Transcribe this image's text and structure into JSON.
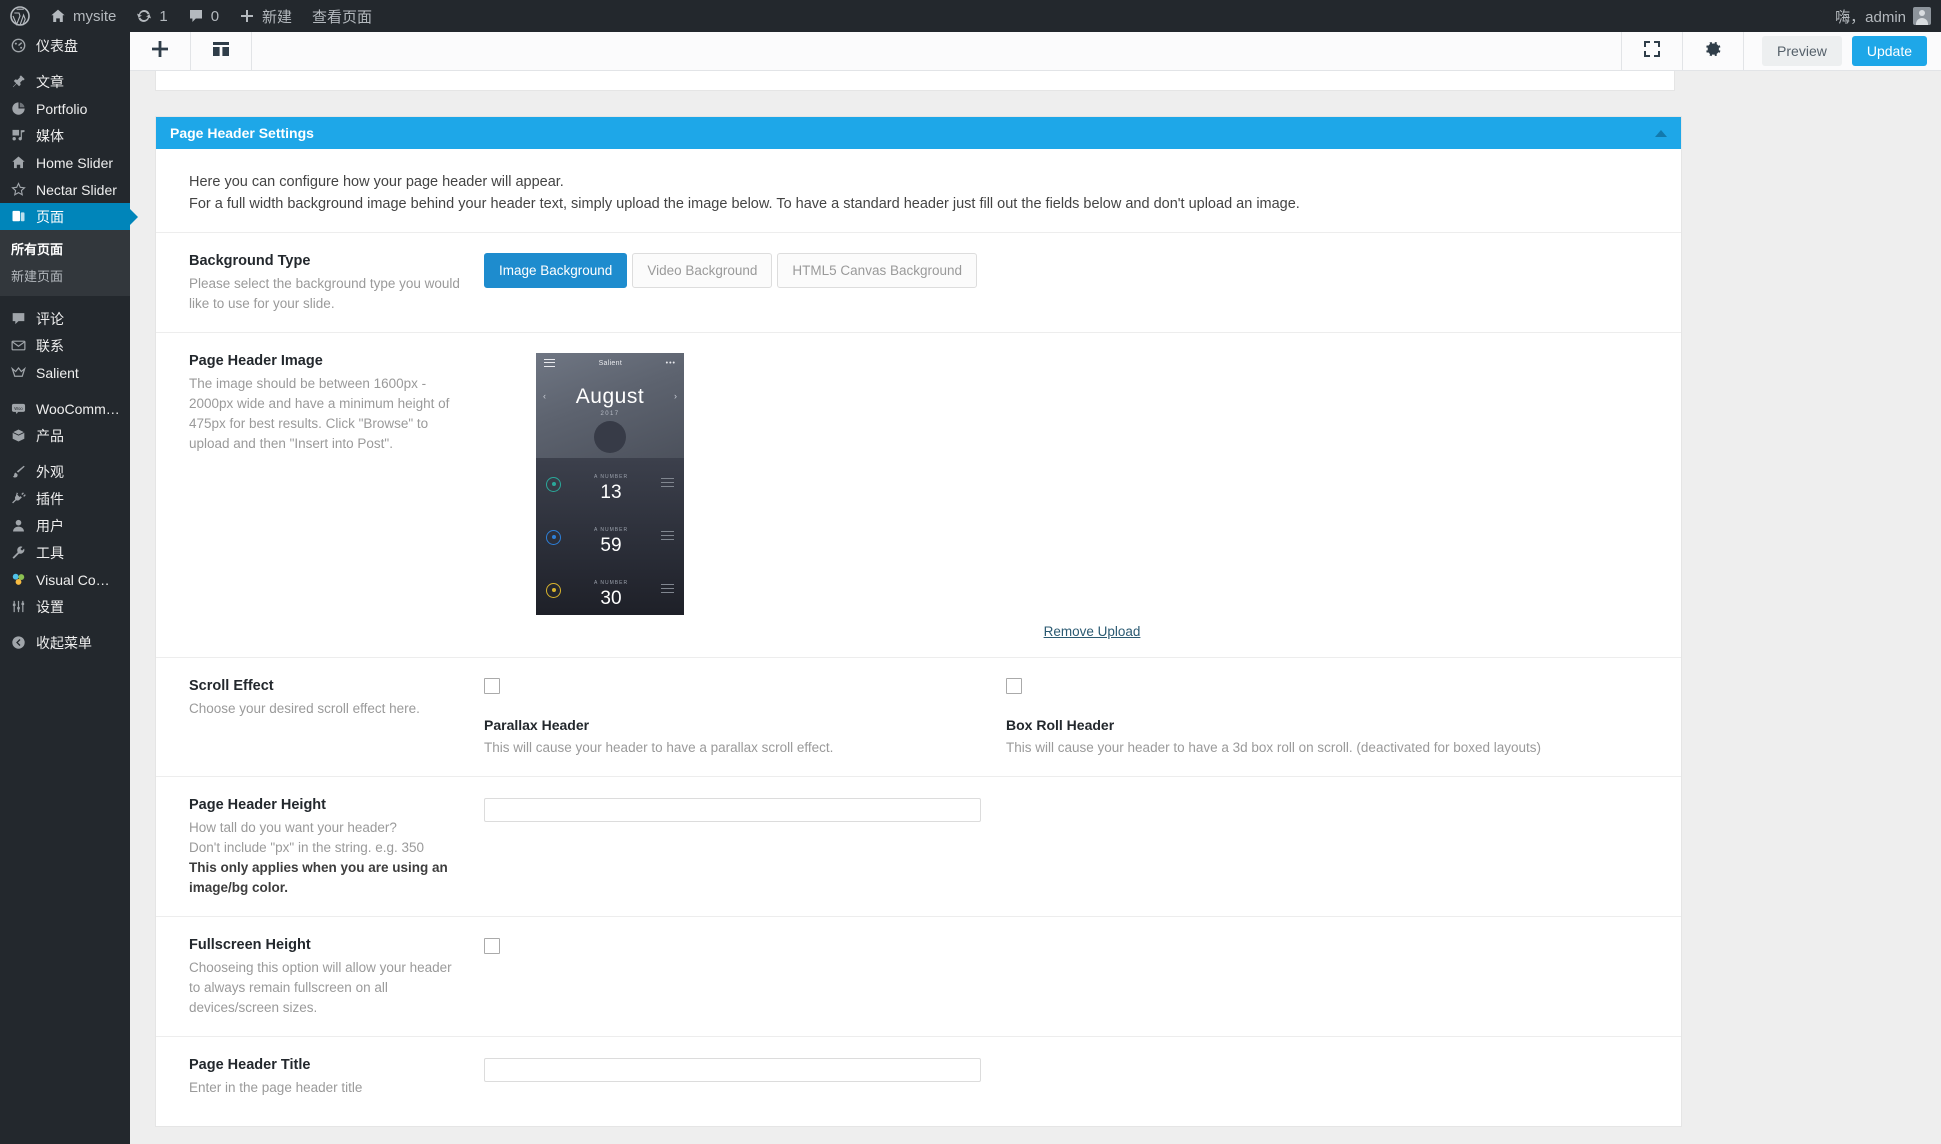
{
  "adminbar": {
    "logo_icon": "wordpress-logo-icon",
    "site_name": "mysite",
    "home_icon": "home-icon",
    "updates_icon": "updates-icon",
    "updates_count": "1",
    "comments_icon": "comment-bubble-icon",
    "comments_count": "0",
    "new_icon": "plus-icon",
    "new_label": "新建",
    "view_page_label": "查看页面",
    "account_greeting": "嗨，admin",
    "avatar_icon": "avatar-icon"
  },
  "sidebar": {
    "items": [
      {
        "label": "仪表盘",
        "icon": "dashboard-icon",
        "sep": false,
        "active": false
      },
      {
        "label": "文章",
        "icon": "pin-icon",
        "sep": true,
        "active": false
      },
      {
        "label": "Portfolio",
        "icon": "portfolio-icon",
        "sep": false,
        "active": false
      },
      {
        "label": "媒体",
        "icon": "media-icon",
        "sep": false,
        "active": false
      },
      {
        "label": "Home Slider",
        "icon": "home-icon",
        "sep": false,
        "active": false
      },
      {
        "label": "Nectar Slider",
        "icon": "star-icon",
        "sep": false,
        "active": false
      },
      {
        "label": "页面",
        "icon": "pages-icon",
        "sep": false,
        "active": true
      }
    ],
    "submenu": [
      {
        "label": "所有页面",
        "current": true
      },
      {
        "label": "新建页面",
        "current": false
      }
    ],
    "items2": [
      {
        "label": "评论",
        "icon": "comment-bubble-icon",
        "sep": true,
        "active": false
      },
      {
        "label": "联系",
        "icon": "envelope-icon",
        "sep": false,
        "active": false
      },
      {
        "label": "Salient",
        "icon": "crown-icon",
        "sep": false,
        "active": false
      },
      {
        "label": "WooCommerce",
        "icon": "woo-icon",
        "sep": true,
        "active": false
      },
      {
        "label": "产品",
        "icon": "box-icon",
        "sep": false,
        "active": false
      },
      {
        "label": "外观",
        "icon": "brush-icon",
        "sep": true,
        "active": false
      },
      {
        "label": "插件",
        "icon": "plug-icon",
        "sep": false,
        "active": false
      },
      {
        "label": "用户",
        "icon": "user-icon",
        "sep": false,
        "active": false
      },
      {
        "label": "工具",
        "icon": "wrench-icon",
        "sep": false,
        "active": false
      },
      {
        "label": "Visual Composer",
        "icon": "visual-composer-icon",
        "sep": false,
        "active": false
      },
      {
        "label": "设置",
        "icon": "settings-sliders-icon",
        "sep": false,
        "active": false
      },
      {
        "label": "收起菜单",
        "icon": "collapse-icon",
        "sep": true,
        "active": false
      }
    ]
  },
  "toolbar": {
    "add_icon": "plus-icon",
    "layout_icon": "layout-blocks-icon",
    "fullscreen_icon": "fullscreen-icon",
    "settings_icon": "gear-icon",
    "preview_label": "Preview",
    "update_label": "Update"
  },
  "panel": {
    "title": "Page Header Settings",
    "collapse_icon": "caret-up-icon",
    "intro_line1": "Here you can configure how your page header will appear.",
    "intro_line2": "For a full width background image behind your header text, simply upload the image below. To have a standard header just fill out the fields below and don't upload an image."
  },
  "background_type": {
    "label": "Background Type",
    "desc": "Please select the background type you would like to use for your slide.",
    "options": [
      {
        "label": "Image Background",
        "selected": true
      },
      {
        "label": "Video Background",
        "selected": false
      },
      {
        "label": "HTML5 Canvas Background",
        "selected": false
      }
    ]
  },
  "page_header_image": {
    "label": "Page Header Image",
    "desc": "The image should be between 1600px - 2000px wide and have a minimum height of 475px for best results. Click \"Browse\" to upload and then \"Insert into Post\".",
    "remove_label": "Remove Upload",
    "thumbnail": {
      "app_name": "Salient",
      "menu_icon": "hamburger-icon",
      "more_icon": "more-dots-icon",
      "month": "August",
      "year": "2017",
      "prev_icon": "chevron-left-icon",
      "next_icon": "chevron-right-icon",
      "rows": [
        {
          "caption": "A NUMBER",
          "value": "13",
          "color": "#2aa89a"
        },
        {
          "caption": "A NUMBER",
          "value": "59",
          "color": "#2d7fd8"
        },
        {
          "caption": "A NUMBER",
          "value": "30",
          "color": "#d8b32d"
        }
      ]
    }
  },
  "scroll_effect": {
    "label": "Scroll Effect",
    "desc": "Choose your desired scroll effect here.",
    "parallax": {
      "title": "Parallax Header",
      "desc": "This will cause your header to have a parallax scroll effect.",
      "checked": false
    },
    "box_roll": {
      "title": "Box Roll Header",
      "desc": "This will cause your header to have a 3d box roll on scroll. (deactivated for boxed layouts)",
      "checked": false
    }
  },
  "page_header_height": {
    "label": "Page Header Height",
    "desc1": "How tall do you want your header?",
    "desc2": "Don't include \"px\" in the string. e.g. 350",
    "desc3": "This only applies when you are using an image/bg color.",
    "value": "",
    "placeholder": ""
  },
  "fullscreen_height": {
    "label": "Fullscreen Height",
    "desc": "Chooseing this option will allow your header to always remain fullscreen on all devices/screen sizes.",
    "checked": false
  },
  "page_header_title": {
    "label": "Page Header Title",
    "desc": "Enter in the page header title",
    "value": "",
    "placeholder": ""
  },
  "colors": {
    "accent_blue": "#1ea7e8",
    "admin_dark": "#23282d",
    "active_blue": "#0085ba",
    "page_bg": "#eeeeee"
  }
}
